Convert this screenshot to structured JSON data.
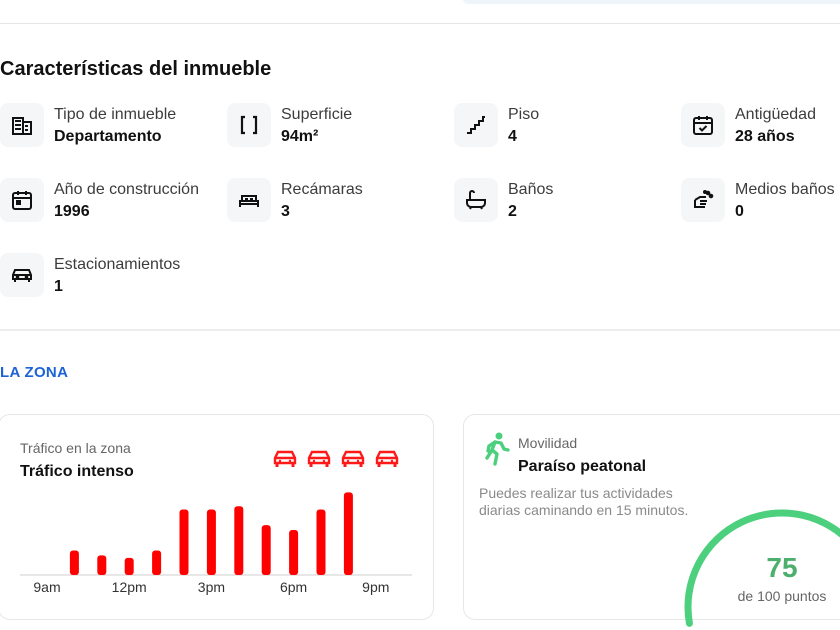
{
  "characteristics": {
    "title": "Características del inmueble",
    "items": [
      {
        "key": "tipo",
        "label": "Tipo de inmueble",
        "value": "Departamento",
        "icon": "building-icon"
      },
      {
        "key": "superficie",
        "label": "Superficie",
        "value": "94m²",
        "icon": "area-brackets-icon"
      },
      {
        "key": "piso",
        "label": "Piso",
        "value": "4",
        "icon": "stairs-icon"
      },
      {
        "key": "antiguedad",
        "label": "Antigüedad",
        "value": "28 años",
        "icon": "calendar-check-icon"
      },
      {
        "key": "anio",
        "label": "Año de construcción",
        "value": "1996",
        "icon": "calendar-icon"
      },
      {
        "key": "recamaras",
        "label": "Recámaras",
        "value": "3",
        "icon": "bed-icon"
      },
      {
        "key": "banos",
        "label": "Baños",
        "value": "2",
        "icon": "bathtub-icon"
      },
      {
        "key": "medios",
        "label": "Medios baños",
        "value": "0",
        "icon": "hand-wash-icon"
      },
      {
        "key": "estacionamientos",
        "label": "Estacionamientos",
        "value": "1",
        "icon": "car-icon"
      }
    ]
  },
  "zone": {
    "title": "LA ZONA",
    "traffic": {
      "sublabel": "Tráfico en la zona",
      "level": "Tráfico intenso",
      "car_icons": 4,
      "color": "#ff0000"
    },
    "mobility": {
      "sublabel": "Movilidad",
      "level": "Paraíso peatonal",
      "description": "Puedes realizar tus actividades diarias caminando en 15 minutos.",
      "score": "75",
      "score_caption": "de 100 puntos",
      "score_value": 75,
      "score_max": 100,
      "color": "#4cd07d"
    }
  },
  "chart_data": {
    "type": "bar",
    "x_ticks": [
      "9am",
      "12pm",
      "3pm",
      "6pm",
      "9pm"
    ],
    "hours": [
      10,
      11,
      12,
      13,
      14,
      15,
      16,
      17,
      18,
      19,
      20
    ],
    "values": [
      3,
      2.4,
      2.1,
      3,
      8,
      8,
      8.4,
      6.1,
      5.5,
      8,
      10.1
    ],
    "ylim": [
      0,
      11
    ],
    "color": "#ff0000",
    "grid": false
  }
}
